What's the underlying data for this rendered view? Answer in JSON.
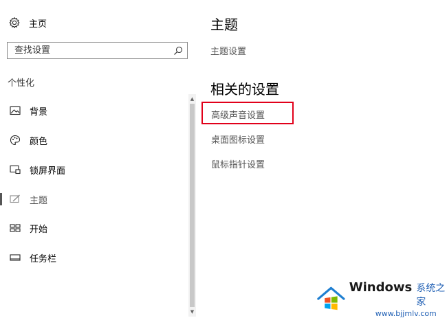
{
  "sidebar": {
    "home_label": "主页",
    "search_placeholder": "查找设置",
    "section_label": "个性化",
    "items": [
      {
        "label": "背景",
        "icon": "image-icon"
      },
      {
        "label": "颜色",
        "icon": "palette-icon"
      },
      {
        "label": "锁屏界面",
        "icon": "lock-screen-icon"
      },
      {
        "label": "主题",
        "icon": "theme-icon",
        "selected": true
      },
      {
        "label": "开始",
        "icon": "start-icon"
      },
      {
        "label": "任务栏",
        "icon": "taskbar-icon"
      }
    ]
  },
  "main": {
    "title": "主题",
    "theme_settings_link": "主题设置",
    "related_heading": "相关的设置",
    "related_links": [
      "高级声音设置",
      "桌面图标设置",
      "鼠标指针设置"
    ]
  },
  "watermark": {
    "brand": "Windows",
    "brand_cn": "系统之家",
    "url": "www.bjjmlv.com"
  },
  "colors": {
    "highlight": "#e1001a",
    "link": "#555555",
    "watermark_blue": "#1f5fb4"
  }
}
